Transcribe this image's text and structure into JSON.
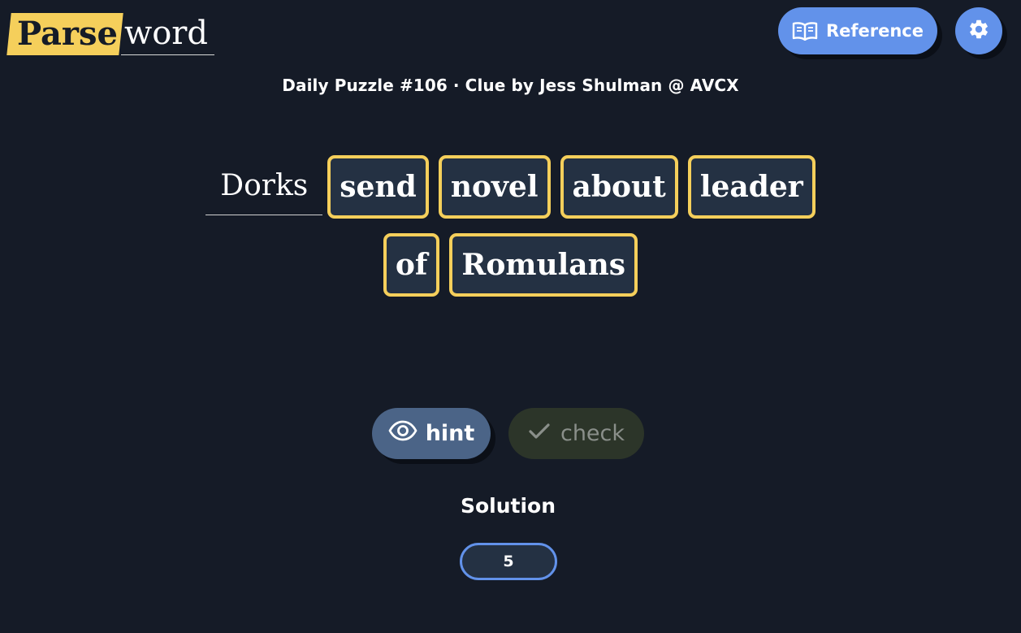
{
  "logo": {
    "part1": "Parse",
    "part2": "word"
  },
  "header": {
    "reference_label": "Reference",
    "reference_icon": "book-open-icon",
    "settings_icon": "gear-icon"
  },
  "subtitle": "Daily Puzzle #106 · Clue by Jess Shulman @ AVCX",
  "clue": {
    "plain_word": "Dorks",
    "row1_tiles": [
      "send",
      "novel",
      "about",
      "leader"
    ],
    "row2_tiles": [
      "of",
      "Romulans"
    ]
  },
  "actions": {
    "hint_label": "hint",
    "hint_icon": "eye-icon",
    "check_label": "check",
    "check_icon": "checkmark-icon"
  },
  "solution": {
    "label": "Solution",
    "length": "5"
  },
  "colors": {
    "background": "#151b27",
    "accent_yellow": "#f5cf5b",
    "accent_blue": "#6292ea",
    "tile_bg": "#243143",
    "hint_bg": "#4b6487",
    "check_bg": "#2c3529"
  }
}
